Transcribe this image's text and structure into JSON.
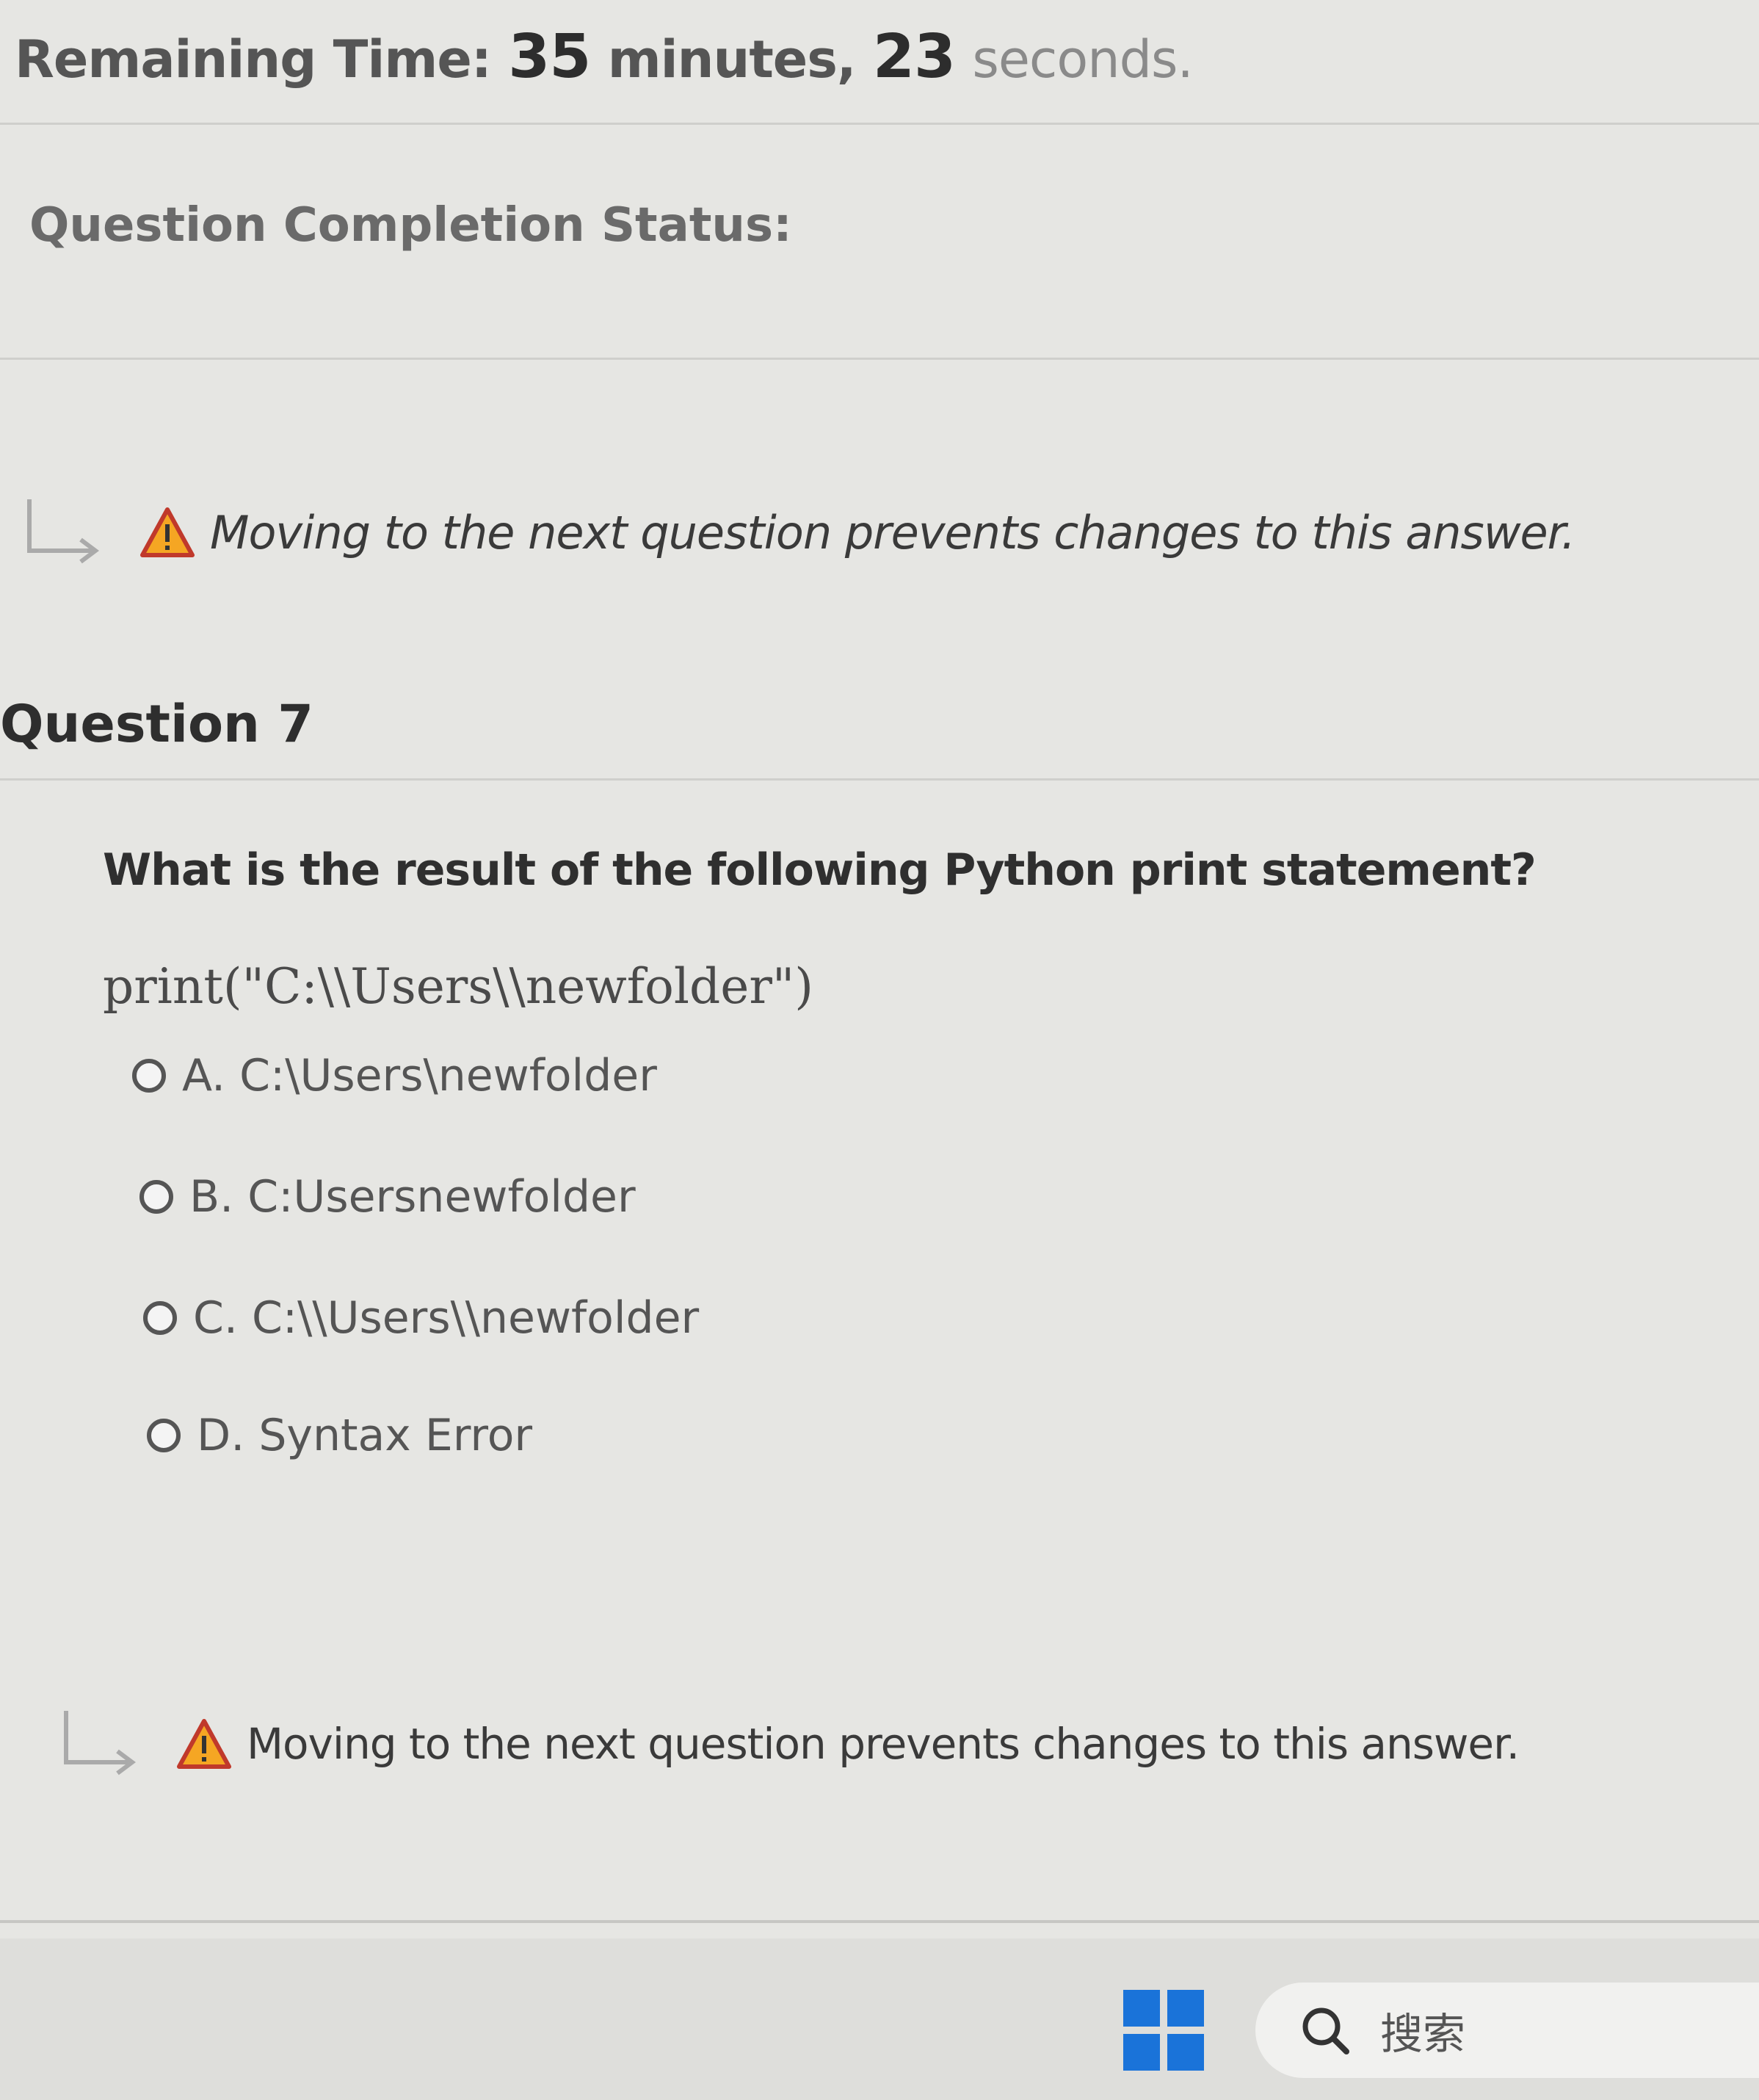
{
  "timer": {
    "label": "Remaining Time:",
    "minutes": "35",
    "minutes_unit": "minutes,",
    "seconds": "23",
    "seconds_unit": "seconds."
  },
  "status": {
    "label": "Question Completion Status:"
  },
  "warning": {
    "text": "Moving to the next question prevents changes to this answer."
  },
  "question": {
    "title": "Question 7",
    "prompt": "What is the result of the following Python print statement?",
    "code": "print(\"C:\\\\Users\\\\newfolder\")",
    "options": [
      {
        "label": "A. C:\\Users\\newfolder"
      },
      {
        "label": "B. C:Usersnewfolder"
      },
      {
        "label": "C. C:\\\\Users\\\\newfolder"
      },
      {
        "label": "D. Syntax Error"
      }
    ]
  },
  "taskbar": {
    "search_label": "搜索"
  },
  "colors": {
    "warning_fill": "#f5a623",
    "warning_border": "#c0392b",
    "start_blue": "#1a73d9"
  },
  "icons": [
    "corner-arrow-icon",
    "warning-triangle-icon",
    "radio-button-icon",
    "windows-start-icon",
    "search-icon"
  ]
}
